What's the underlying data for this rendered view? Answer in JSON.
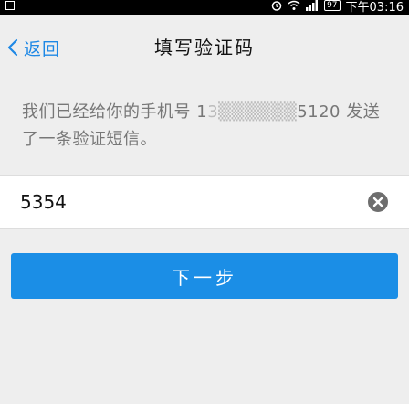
{
  "status_bar": {
    "battery": "97",
    "time": "下午03:16"
  },
  "nav": {
    "back_label": "返回",
    "title": "填写验证码"
  },
  "message": {
    "prefix": "我们已经给你的手机号 ",
    "masked_phone": "1",
    "masked_hidden": "3▒▒▒▒▒▒",
    "phone_suffix": "5120",
    "suffix": " 发送了一条验证短信。"
  },
  "code_input": {
    "value": "5354",
    "placeholder": ""
  },
  "next_button": {
    "label": "下一步"
  },
  "colors": {
    "accent": "#1b8ee6",
    "background": "#eeeeee",
    "text_secondary": "#777777"
  },
  "icons": {
    "back": "chevron-left-icon",
    "clear": "clear-circle-icon",
    "wifi": "wifi-icon",
    "signal": "signal-icon",
    "alarm": "alarm-icon"
  }
}
